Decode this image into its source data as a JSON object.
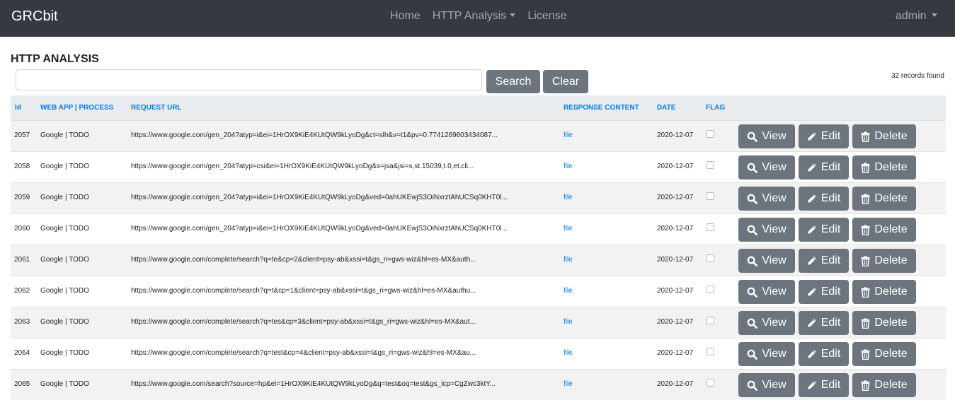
{
  "navbar": {
    "brand": "GRCbit",
    "items": [
      {
        "label": "Home"
      },
      {
        "label": "HTTP Analysis"
      },
      {
        "label": "License"
      }
    ],
    "user": "admin"
  },
  "page": {
    "title": "HTTP ANALYSIS",
    "search": {
      "value": "",
      "placeholder": ""
    },
    "search_label": "Search",
    "clear_label": "Clear",
    "records_found": "32 records found"
  },
  "table": {
    "columns": [
      "Id",
      "WEB APP | PROCESS",
      "REQUEST URL",
      "RESPONSE CONTENT",
      "DATE",
      "FLAG"
    ],
    "actions": {
      "view": "View",
      "edit": "Edit",
      "delete": "Delete"
    },
    "rows": [
      {
        "id": "2057",
        "app": "Google | TODO",
        "url": "https://www.google.com/gen_204?atyp=i&ei=1HrOX9KiE4KUtQW9kLyoDg&ct=slh&v=t1&pv=0.7741269603434087...",
        "content": "file",
        "date": "2020-12-07",
        "flag": false
      },
      {
        "id": "2058",
        "app": "Google | TODO",
        "url": "https://www.google.com/gen_204?atyp=csi&ei=1HrOX9KiE4KUtQW9kLyoDg&s=jsa&jsi=s,st.15039,t.0,et.cli...",
        "content": "file",
        "date": "2020-12-07",
        "flag": false
      },
      {
        "id": "2059",
        "app": "Google | TODO",
        "url": "https://www.google.com/gen_204?atyp=i&ei=1HrOX9KiE4KUtQW9kLyoDg&ved=0ahUKEwjS3OiNxrztAhUCSq0KHT0l...",
        "content": "file",
        "date": "2020-12-07",
        "flag": false
      },
      {
        "id": "2060",
        "app": "Google | TODO",
        "url": "https://www.google.com/gen_204?atyp=i&ei=1HrOX9KiE4KUtQW9kLyoDg&ved=0ahUKEwjS3OiNxrztAhUCSq0KHT0l...",
        "content": "file",
        "date": "2020-12-07",
        "flag": false
      },
      {
        "id": "2061",
        "app": "Google | TODO",
        "url": "https://www.google.com/complete/search?q=te&cp=2&client=psy-ab&xssi=t&gs_ri=gws-wiz&hl=es-MX&auth...",
        "content": "file",
        "date": "2020-12-07",
        "flag": false
      },
      {
        "id": "2062",
        "app": "Google | TODO",
        "url": "https://www.google.com/complete/search?q=t&cp=1&client=psy-ab&xssi=t&gs_ri=gws-wiz&hl=es-MX&authu...",
        "content": "file",
        "date": "2020-12-07",
        "flag": false
      },
      {
        "id": "2063",
        "app": "Google | TODO",
        "url": "https://www.google.com/complete/search?q=tes&cp=3&client=psy-ab&xssi=t&gs_ri=gws-wiz&hl=es-MX&aut...",
        "content": "file",
        "date": "2020-12-07",
        "flag": false
      },
      {
        "id": "2064",
        "app": "Google | TODO",
        "url": "https://www.google.com/complete/search?q=test&cp=4&client=psy-ab&xssi=t&gs_ri=gws-wiz&hl=es-MX&au...",
        "content": "file",
        "date": "2020-12-07",
        "flag": false
      },
      {
        "id": "2065",
        "app": "Google | TODO",
        "url": "https://www.google.com/search?source=hp&ei=1HrOX9KiE4KUtQW9kLyoDg&q=test&oq=test&gs_lcp=CgZwc3ktY...",
        "content": "file",
        "date": "2020-12-07",
        "flag": false
      }
    ]
  },
  "colors": {
    "navbar": "#343a40",
    "button": "#6c757d",
    "link": "#007bff",
    "header_bg": "#e9ecef",
    "stripe": "#f2f2f2"
  },
  "icons": {
    "view": "search-icon",
    "edit": "pencil-icon",
    "delete": "trash-icon",
    "dropdown": "caret-down-icon"
  }
}
